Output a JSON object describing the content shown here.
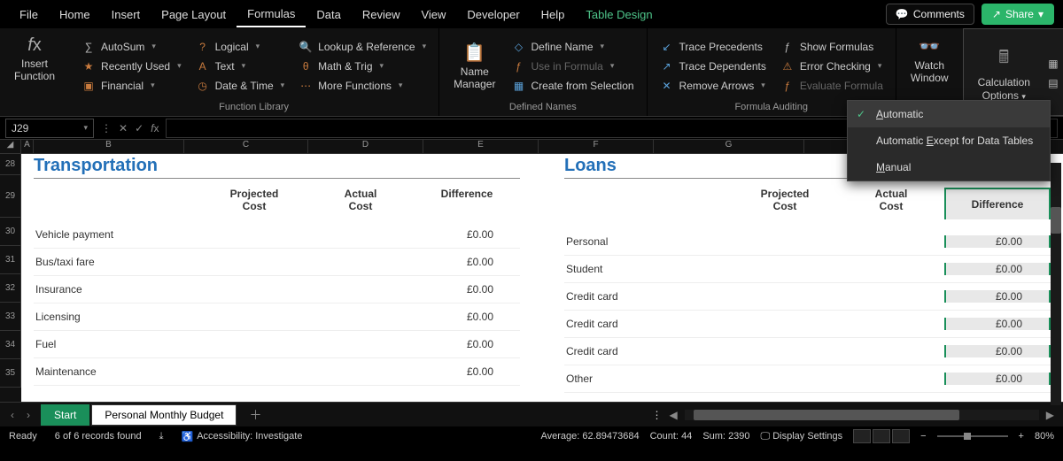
{
  "tabs": {
    "file": "File",
    "home": "Home",
    "insert": "Insert",
    "page_layout": "Page Layout",
    "formulas": "Formulas",
    "data": "Data",
    "review": "Review",
    "view": "View",
    "developer": "Developer",
    "help": "Help",
    "table_design": "Table Design"
  },
  "header_buttons": {
    "comments": "Comments",
    "share": "Share"
  },
  "ribbon": {
    "insert_function": "Insert\nFunction",
    "function_library": {
      "label": "Function Library",
      "autosum": "AutoSum",
      "recently_used": "Recently Used",
      "financial": "Financial",
      "logical": "Logical",
      "text": "Text",
      "date_time": "Date & Time",
      "lookup_ref": "Lookup & Reference",
      "math_trig": "Math & Trig",
      "more_functions": "More Functions"
    },
    "name_manager": "Name\nManager",
    "defined_names": {
      "label": "Defined Names",
      "define_name": "Define Name",
      "use_in_formula": "Use in Formula",
      "create_selection": "Create from Selection"
    },
    "formula_auditing": {
      "label": "Formula Auditing",
      "trace_precedents": "Trace Precedents",
      "trace_dependents": "Trace Dependents",
      "remove_arrows": "Remove Arrows",
      "show_formulas": "Show Formulas",
      "error_checking": "Error Checking",
      "evaluate_formula": "Evaluate Formula"
    },
    "watch_window": "Watch\nWindow",
    "calculation_options": "Calculation\nOptions"
  },
  "calc_menu": {
    "automatic": "Automatic",
    "auto_except": "Automatic Except for Data Tables",
    "manual": "Manual"
  },
  "name_box": "J29",
  "columns": [
    "A",
    "B",
    "C",
    "D",
    "E",
    "F",
    "G",
    "H"
  ],
  "rows": [
    "28",
    "29",
    "30",
    "31",
    "32",
    "33",
    "34",
    "35"
  ],
  "table1": {
    "title": "Transportation",
    "headers": {
      "projected": "Projected Cost",
      "actual": "Actual Cost",
      "difference": "Difference"
    },
    "rows": [
      {
        "label": "Vehicle payment",
        "diff": "£0.00"
      },
      {
        "label": "Bus/taxi fare",
        "diff": "£0.00"
      },
      {
        "label": "Insurance",
        "diff": "£0.00"
      },
      {
        "label": "Licensing",
        "diff": "£0.00"
      },
      {
        "label": "Fuel",
        "diff": "£0.00"
      },
      {
        "label": "Maintenance",
        "diff": "£0.00"
      }
    ]
  },
  "table2": {
    "title": "Loans",
    "headers": {
      "projected": "Projected Cost",
      "actual": "Actual Cost",
      "difference": "Difference"
    },
    "rows": [
      {
        "label": "Personal",
        "diff": "£0.00"
      },
      {
        "label": "Student",
        "diff": "£0.00"
      },
      {
        "label": "Credit card",
        "diff": "£0.00"
      },
      {
        "label": "Credit card",
        "diff": "£0.00"
      },
      {
        "label": "Credit card",
        "diff": "£0.00"
      },
      {
        "label": "Other",
        "diff": "£0.00"
      }
    ]
  },
  "sheet_tabs": {
    "start": "Start",
    "budget": "Personal Monthly Budget"
  },
  "status": {
    "ready": "Ready",
    "records": "6 of 6 records found",
    "accessibility": "Accessibility: Investigate",
    "average_label": "Average:",
    "average": "62.89473684",
    "count_label": "Count:",
    "count": "44",
    "sum_label": "Sum:",
    "sum": "2390",
    "display_settings": "Display Settings",
    "zoom": "80%"
  }
}
